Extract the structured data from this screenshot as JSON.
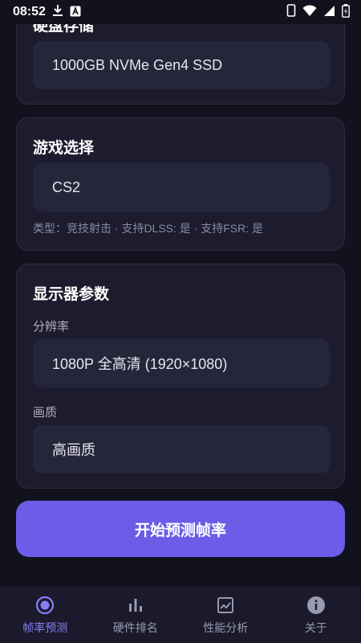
{
  "status_bar": {
    "time": "08:52"
  },
  "storage_card": {
    "title": "硬盘存储",
    "value": "1000GB NVMe Gen4 SSD"
  },
  "game_card": {
    "title": "游戏选择",
    "value": "CS2",
    "info": "类型：竞技射击 · 支持DLSS: 是 · 支持FSR: 是"
  },
  "display_card": {
    "title": "显示器参数",
    "resolution_label": "分辨率",
    "resolution_value": "1080P 全高清 (1920×1080)",
    "quality_label": "画质",
    "quality_value": "高画质"
  },
  "predict_button": {
    "label": "开始预测帧率"
  },
  "bottom_nav": {
    "items": [
      {
        "label": "帧率预测",
        "icon": "radio-target-icon",
        "active": true
      },
      {
        "label": "硬件排名",
        "icon": "bar-chart-icon",
        "active": false
      },
      {
        "label": "性能分析",
        "icon": "analytics-icon",
        "active": false
      },
      {
        "label": "关于",
        "icon": "info-icon",
        "active": false
      }
    ]
  },
  "colors": {
    "background": "#12121e",
    "card": "#1c1c2e",
    "field": "#26263a",
    "accent": "#6c5ce7",
    "accent_text": "#8b7cf6"
  }
}
